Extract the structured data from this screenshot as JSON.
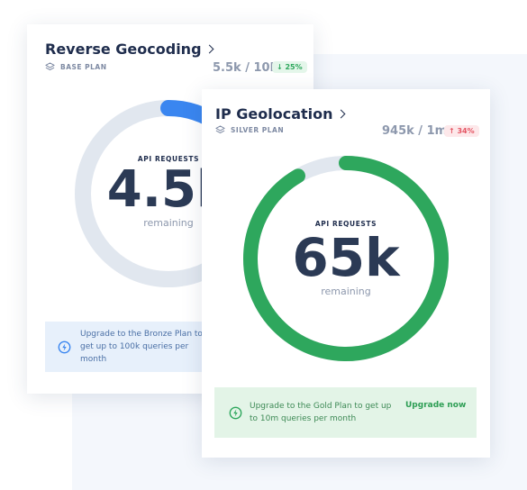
{
  "cards": {
    "reverse_geocoding": {
      "title": "Reverse Geocoding",
      "plan": "BASE PLAN",
      "usage": "5.5k / 10k",
      "change": "↓ 25%",
      "api_label": "API REQUESTS",
      "remaining_value": "4.5k",
      "remaining_label": "remaining",
      "fraction_used": 0.55,
      "ring_color": "#3a86f0",
      "upgrade_text": "Upgrade to the Bronze Plan to get up to 100k queries per month"
    },
    "ip_geolocation": {
      "title": "IP Geolocation",
      "plan": "SILVER PLAN",
      "usage": "945k / 1m",
      "change": "↑ 34%",
      "api_label": "API REQUESTS",
      "remaining_value": "65k",
      "remaining_label": "remaining",
      "fraction_used": 0.945,
      "ring_color": "#2ea75d",
      "upgrade_text": "Upgrade to the Gold Plan to get up to 10m queries per month",
      "upgrade_link": "Upgrade now"
    }
  },
  "colors": {
    "track": "#e1e7ef",
    "blue_box": "#e7f0fb",
    "green_box": "#e3f4e7"
  },
  "icons": {
    "plan": "layers-icon",
    "upgrade": "lightning-bolt-icon",
    "title_arrow": "chevron-right-icon"
  }
}
